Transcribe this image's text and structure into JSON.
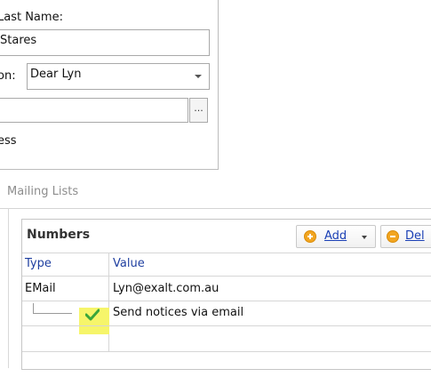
{
  "contact": {
    "last_name_label": "Last Name:",
    "last_name_value": "Stares",
    "salutation_label": "on:",
    "salutation_value": "Dear Lyn",
    "address_value": "",
    "address_button": "...",
    "address_label": "ess"
  },
  "tabs": {
    "mailing_lists": "Mailing Lists"
  },
  "numbers_group": {
    "title": "Numbers",
    "add_label": "Add",
    "delete_label": "Del",
    "columns": {
      "type": "Type",
      "value": "Value"
    },
    "rows": [
      {
        "type": "EMail",
        "value": "Lyn@exalt.com.au"
      }
    ],
    "child_row": {
      "checked": true,
      "label": "Send notices via email"
    }
  },
  "colors": {
    "accent_link": "#1a3fb5",
    "header_text": "#1f3fa0",
    "highlight": "#f6f56a",
    "check_green": "#3aa63a",
    "add_icon": "#f2a520"
  }
}
